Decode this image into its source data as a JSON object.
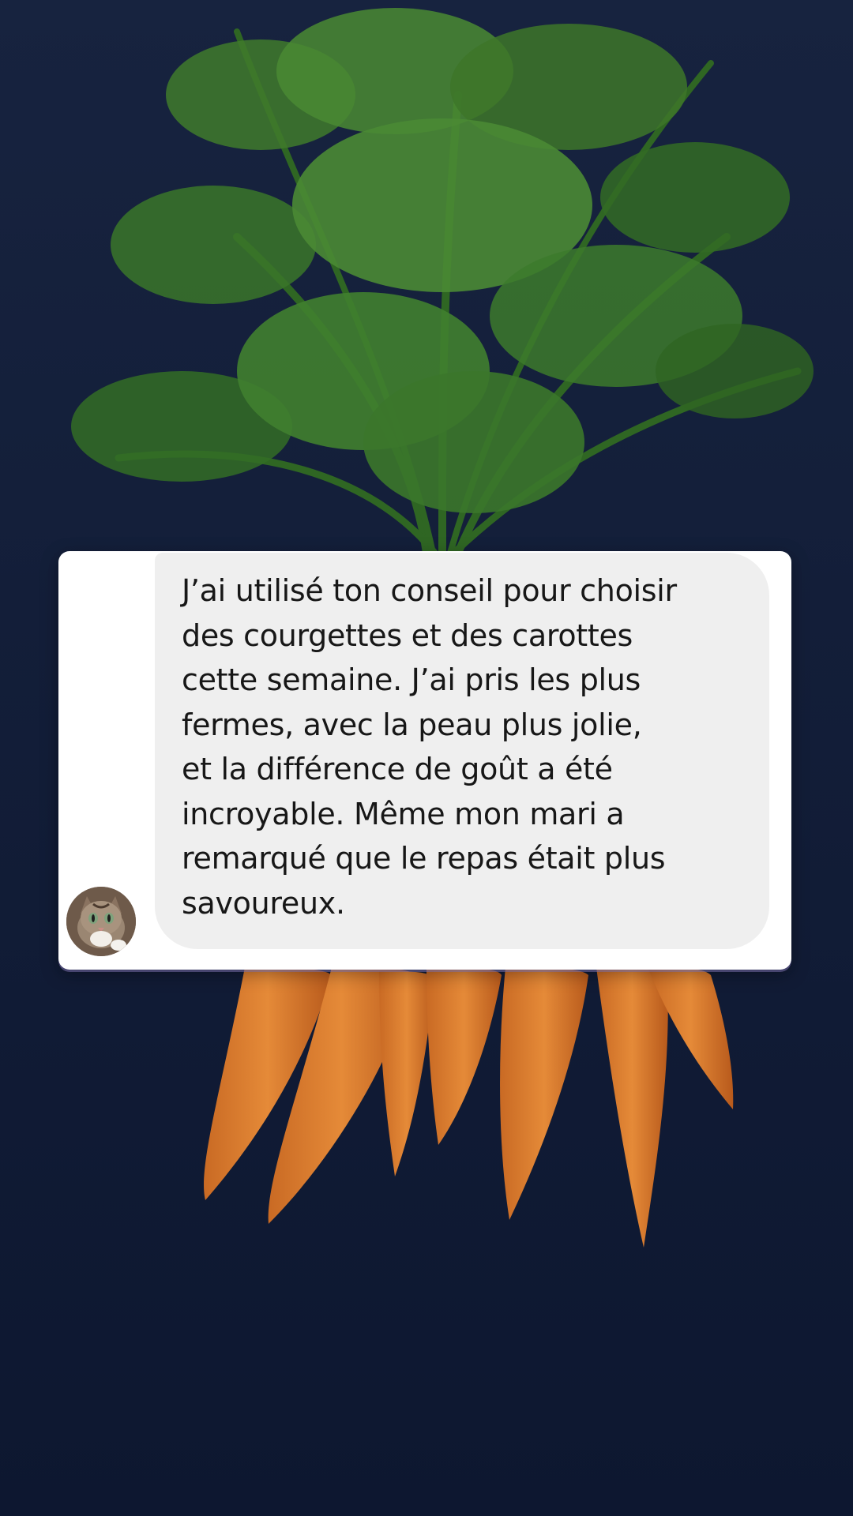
{
  "message": {
    "text": "J’ai utilisé ton conseil pour choisir\ndes courgettes et des carottes\ncette semaine. J’ai pris les plus\nfermes, avec la peau plus jolie,\net la différence de goût a été\nincroyable. Même mon mari a\nremarqué que le repas était plus\nsavoureux."
  },
  "sender": {
    "avatar_icon": "cat-avatar-icon"
  },
  "colors": {
    "background": "#101a33",
    "card": "#ffffff",
    "bubble": "#efefef",
    "text": "#171717",
    "carrot": "#d9782b",
    "leaves": "#3f7a2c"
  }
}
